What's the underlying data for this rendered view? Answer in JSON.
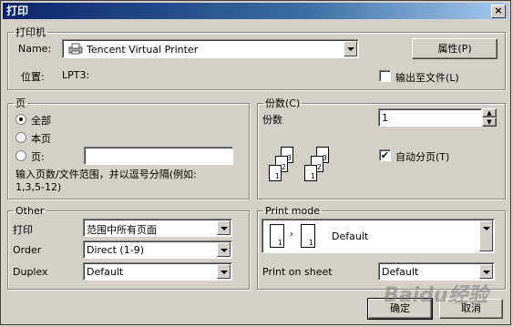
{
  "window": {
    "title": "打印",
    "close_glyph": "×"
  },
  "printer": {
    "group_label": "打印机",
    "name_label": "Name:",
    "name_value": "Tencent Virtual Printer",
    "properties_button": "属性(P)",
    "location_label": "位置:",
    "location_value": "LPT3:",
    "print_to_file_label": "输出至文件(L)",
    "print_to_file_checked": false
  },
  "pages": {
    "group_label": "页",
    "all_label": "全部",
    "current_label": "本页",
    "pages_label": "页:",
    "pages_value": "",
    "selected": "all",
    "hint": "输入页数/文件范围，并以逗号分隔(例如:\n1,3,5-12)"
  },
  "copies": {
    "group_label": "份数(C)",
    "count_label": "份数",
    "count_value": "1",
    "collate_label": "自动分页(T)",
    "collate_checked": true,
    "collate_icon_pages": [
      "3",
      "2",
      "1",
      "3",
      "2",
      "1"
    ]
  },
  "other": {
    "group_label": "Other",
    "print_label": "打印",
    "print_value": "范围中所有页面",
    "order_label": "Order",
    "order_value": "Direct (1-9)",
    "duplex_label": "Duplex",
    "duplex_value": "Default"
  },
  "print_mode": {
    "group_label": "Print mode",
    "mode_value": "Default",
    "mode_icon_pages": [
      "1",
      "1"
    ],
    "sheet_label": "Print on sheet",
    "sheet_value": "Default"
  },
  "buttons": {
    "ok": "确定",
    "cancel": "取消"
  },
  "watermark": "Baidu经验"
}
